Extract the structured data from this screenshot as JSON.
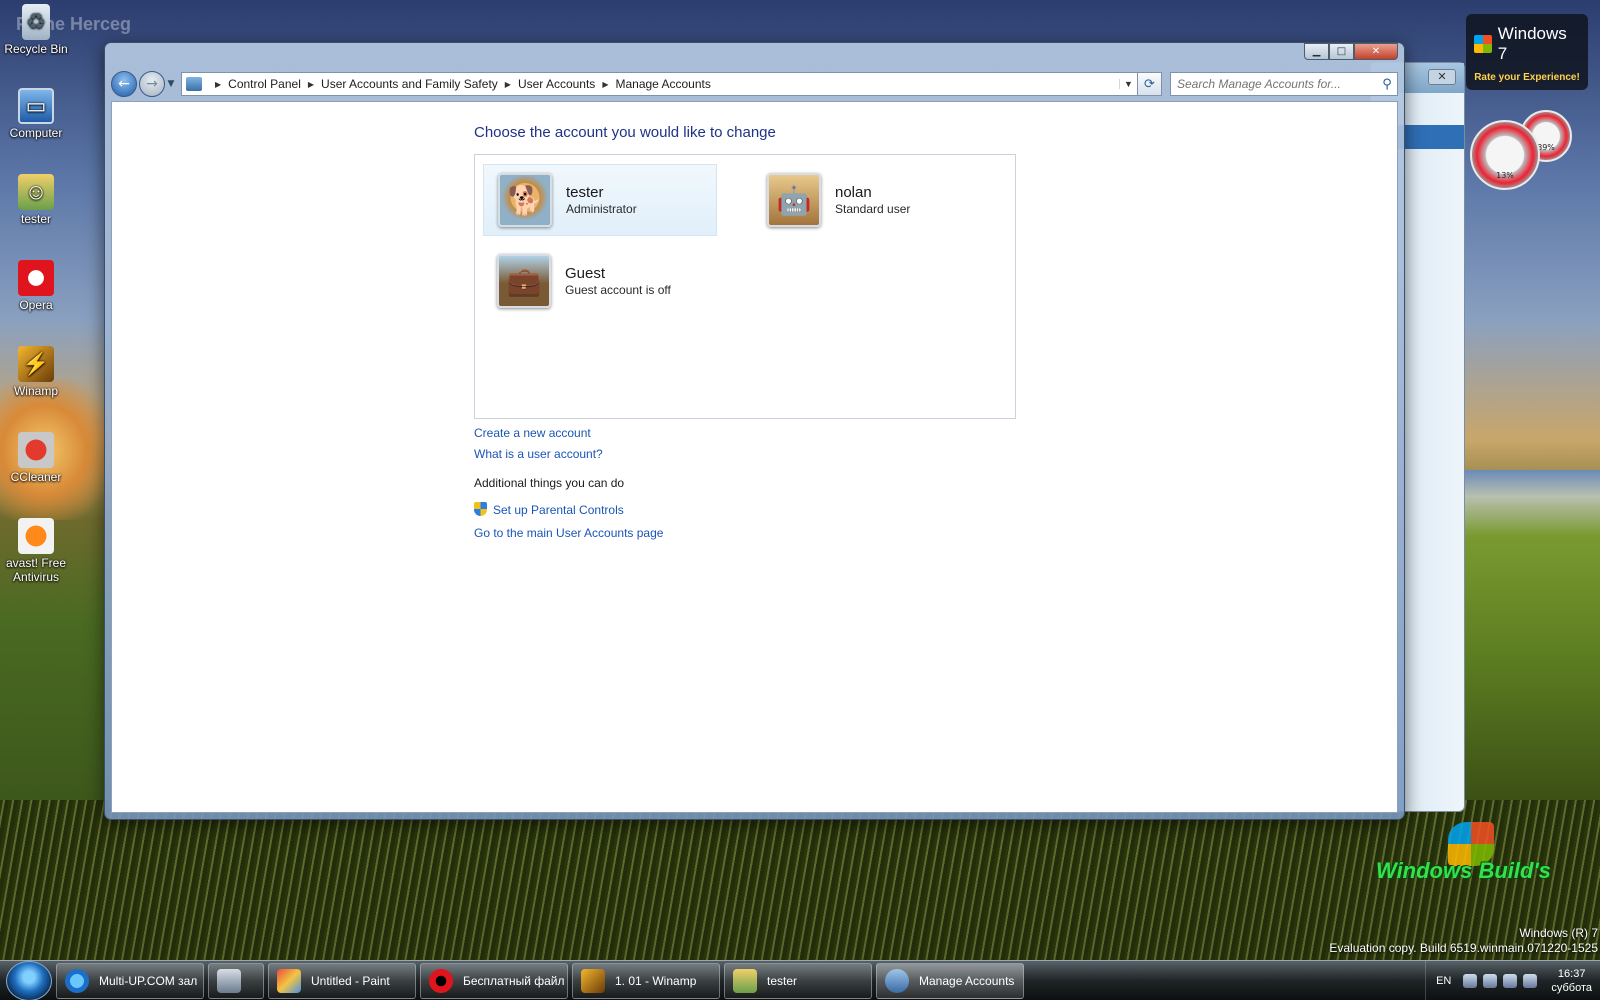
{
  "desktop": {
    "watermark": "Frane Herceg",
    "icons": [
      {
        "label": "Recycle Bin",
        "icon": "recycle-bin-icon"
      },
      {
        "label": "Computer",
        "icon": "computer-icon"
      },
      {
        "label": "tester",
        "icon": "user-folder-icon"
      },
      {
        "label": "Opera",
        "icon": "opera-icon"
      },
      {
        "label": "Winamp",
        "icon": "winamp-icon"
      },
      {
        "label": "CCleaner",
        "icon": "ccleaner-icon"
      },
      {
        "label": "avast! Free Antivirus",
        "icon": "avast-icon"
      }
    ]
  },
  "window": {
    "breadcrumb": [
      "Control Panel",
      "User Accounts and Family Safety",
      "User Accounts",
      "Manage Accounts"
    ],
    "search_placeholder": "Search Manage Accounts for...",
    "title": "Choose the account you would like to change",
    "accounts": [
      {
        "name": "tester",
        "role": "Administrator",
        "avatar": "dog-avatar",
        "selected": true
      },
      {
        "name": "nolan",
        "role": "Standard user",
        "avatar": "robot-avatar",
        "selected": false
      },
      {
        "name": "Guest",
        "role": "Guest account is off",
        "avatar": "suitcase-avatar",
        "selected": false
      }
    ],
    "links": {
      "create_account": "Create a new account",
      "what_is_account": "What is a user account?"
    },
    "additional_label": "Additional things you can do",
    "additional_links": {
      "parental_controls": "Set up Parental Controls",
      "main_page": "Go to the main User Accounts page"
    }
  },
  "gadgets": {
    "win7_title": "Windows 7",
    "win7_subtitle": "Rate your Experience!",
    "cpu_meter": "13%",
    "ram_meter": "89%",
    "brand_logo": "Windows Build's"
  },
  "build_info": {
    "line1": "Windows (R) 7",
    "line2": "Evaluation copy. Build 6519.winmain.071220-1525"
  },
  "taskbar": {
    "tasks": [
      {
        "label": "Multi-UP.COM зал",
        "icon": "internet-explorer-icon",
        "active": false
      },
      {
        "label": "",
        "icon": "document-icon",
        "active": false
      },
      {
        "label": "Untitled - Paint",
        "icon": "paint-icon",
        "active": false
      },
      {
        "label": "Бесплатный файл",
        "icon": "opera-icon",
        "active": false
      },
      {
        "label": "1. 01 - Winamp",
        "icon": "winamp-icon",
        "active": false
      },
      {
        "label": "tester",
        "icon": "user-folder-icon",
        "active": false
      },
      {
        "label": "Manage Accounts",
        "icon": "user-accounts-icon",
        "active": true
      }
    ],
    "language": "EN",
    "time": "16:37",
    "day": "суббота"
  }
}
